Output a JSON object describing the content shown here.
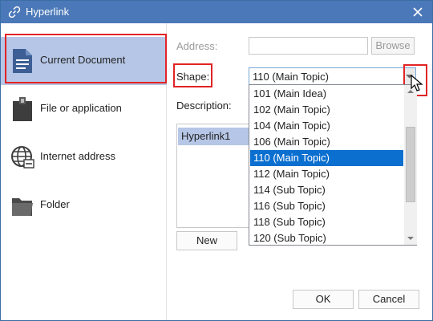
{
  "window": {
    "title": "Hyperlink"
  },
  "sidebar": {
    "items": [
      {
        "label": "Current Document",
        "icon": "document-icon",
        "selected": true
      },
      {
        "label": "File or application",
        "icon": "file-app-icon",
        "selected": false
      },
      {
        "label": "Internet address",
        "icon": "globe-icon",
        "selected": false
      },
      {
        "label": "Folder",
        "icon": "folder-icon",
        "selected": false
      }
    ]
  },
  "form": {
    "address_label": "Address:",
    "address_value": "",
    "browse_label": "Browse",
    "shape_label": "Shape:",
    "shape_value": "110 (Main Topic)",
    "description_label": "Description:",
    "hyperlinks": [
      "Hyperlink1"
    ],
    "new_label": "New"
  },
  "dropdown": {
    "options": [
      "101 (Main Idea)",
      "102 (Main Topic)",
      "104 (Main Topic)",
      "106 (Main Topic)",
      "110 (Main Topic)",
      "112 (Main Topic)",
      "114 (Sub Topic)",
      "116 (Sub Topic)",
      "118 (Sub Topic)",
      "120 (Sub Topic)"
    ],
    "selected_index": 4
  },
  "footer": {
    "ok_label": "OK",
    "cancel_label": "Cancel"
  },
  "colors": {
    "titlebar": "#4a78b8",
    "selection": "#0b6fd0",
    "sidebar_selected": "#b6c6e6",
    "highlight_box": "#e12424"
  }
}
